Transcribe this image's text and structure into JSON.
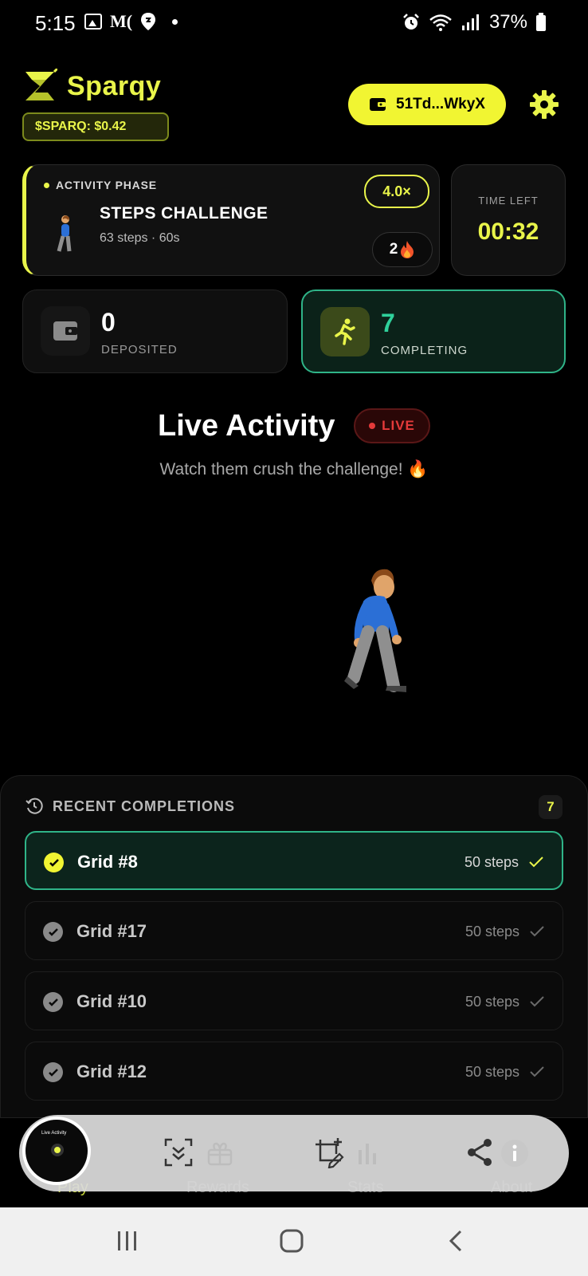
{
  "status_bar": {
    "time": "5:15",
    "left_text": "M(",
    "battery": "37%",
    "icons": [
      "gallery-icon",
      "messenger-icon",
      "location-pin-icon",
      "alarm-icon",
      "wifi-icon",
      "signal-icon",
      "battery-icon"
    ]
  },
  "header": {
    "app_name": "Sparqy",
    "token_price": "$SPARQ: $0.42",
    "wallet_address": "51Td...WkyX",
    "accent_color": "#e9f54a"
  },
  "phase": {
    "label": "ACTIVITY PHASE",
    "title": "STEPS CHALLENGE",
    "subtitle": "63 steps · 60s",
    "multiplier": "4.0×",
    "streak": "2",
    "time_left_label": "TIME LEFT",
    "time_left": "00:32"
  },
  "stats": {
    "deposited_value": "0",
    "deposited_label": "DEPOSITED",
    "completing_value": "7",
    "completing_label": "COMPLETING"
  },
  "live": {
    "title": "Live Activity",
    "badge": "LIVE",
    "subtitle": "Watch them crush the challenge! 🔥"
  },
  "recent": {
    "title": "RECENT COMPLETIONS",
    "count": "7",
    "rows": [
      {
        "name": "Grid #8",
        "steps": "50 steps",
        "active": true
      },
      {
        "name": "Grid #17",
        "steps": "50 steps",
        "active": false
      },
      {
        "name": "Grid #10",
        "steps": "50 steps",
        "active": false
      },
      {
        "name": "Grid #12",
        "steps": "50 steps",
        "active": false
      }
    ]
  },
  "nav": {
    "items": [
      {
        "label": "Play",
        "icon": "play-icon"
      },
      {
        "label": "Rewards",
        "icon": "gift-icon"
      },
      {
        "label": "Stats",
        "icon": "bar-chart-icon"
      },
      {
        "label": "About",
        "icon": "info-icon"
      }
    ],
    "overlay_thumb_title": "Live Activity",
    "overlay_icons": [
      "capture-icon",
      "draw-crop-icon",
      "share-icon"
    ]
  },
  "system_nav": [
    "recents-icon",
    "home-icon",
    "back-icon"
  ]
}
